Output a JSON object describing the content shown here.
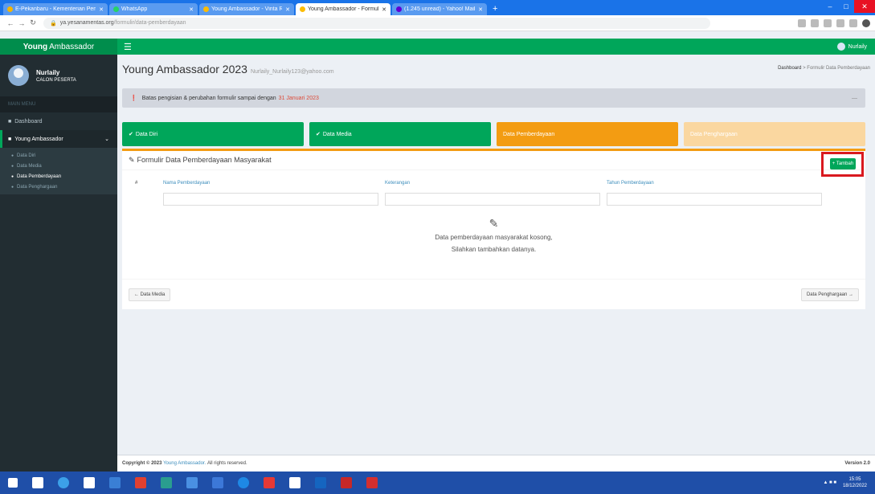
{
  "browser": {
    "tabs": [
      {
        "label": "E-Pekanbaru - Kementerian Pemu",
        "fav": "#f4b400",
        "active": false,
        "width": 130
      },
      {
        "label": "WhatsApp",
        "fav": "#25d366",
        "active": false,
        "width": 110
      },
      {
        "label": "Young Ambassador - Vinta Ram",
        "fav": "#fbbc05",
        "active": false,
        "width": 118
      },
      {
        "label": "Young Ambassador - Formulir D",
        "fav": "#fbbc05",
        "active": true,
        "width": 118
      },
      {
        "label": "(1.245 unread) - Yahoo! Mail",
        "fav": "#6001d2",
        "active": false,
        "width": 118
      }
    ],
    "new_tab": "+",
    "url_domain": "ya.yesanamentas.org",
    "url_path": "/formulir/data-pemberdayaan"
  },
  "app": {
    "logo_bold": "Young",
    "logo_light": "Ambassador",
    "user_name": "Nurlaily"
  },
  "sidebar": {
    "user_name": "Nurlaily",
    "user_status": "CALON PESERTA",
    "header": "MAIN MENU",
    "dashboard": "Dashboard",
    "young_ambassador": "Young Ambassador",
    "sub_items": [
      "Data Diri",
      "Data Media",
      "Data Pemberdayaan",
      "Data Penghargaan"
    ]
  },
  "page": {
    "title": "Young Ambassador 2023",
    "subtitle": "Nurlaily_Nurlaily123@yahoo.com",
    "breadcrumb_home": "Dashboard",
    "breadcrumb_current": "Formulir Data Pemberdayaan"
  },
  "alert": {
    "text": "Batas pengisian & perubahan formulir sampai dengan",
    "date": "31 Januari 2023"
  },
  "steps": [
    {
      "label": "Data Diri",
      "color": "#00a65a",
      "icon": "check"
    },
    {
      "label": "Data Media",
      "color": "#00a65a",
      "icon": "check"
    },
    {
      "label": "Data Pemberdayaan",
      "color": "#f39c12",
      "icon": ""
    },
    {
      "label": "Data Penghargaan",
      "color": "#fad7a0",
      "icon": ""
    }
  ],
  "form": {
    "title": "Formulir Data Pemberdayaan Masyarakat",
    "add_label": "+ Tambah",
    "col_no": "#",
    "col_nama": "Nama Pemberdayaan",
    "col_ket": "Keterangan",
    "col_tahun": "Tahun Pemberdayaan",
    "empty_line1": "Data pemberdayaan masyarakat kosong,",
    "empty_line2": "Silahkan tambahkan datanya.",
    "prev_label": "← Data Media",
    "next_label": "Data Penghargaan →"
  },
  "footer": {
    "copyright": "Copyright © 2023",
    "brand": "Young Ambassador.",
    "rights": "All rights reserved.",
    "version": "Version 2.0"
  },
  "taskbar": {
    "time": "15:05",
    "date": "18/12/2022",
    "icons": [
      "#ffffff",
      "#ffffff",
      "#3ca0e8",
      "#ffffff",
      "#3a7fd5",
      "#e04030",
      "#2a9d8f",
      "#4a90e2",
      "#3c78d8",
      "#1e88e5",
      "#e53935",
      "#ffffff",
      "#1565c0",
      "#c62828",
      "#d32f2f"
    ]
  }
}
